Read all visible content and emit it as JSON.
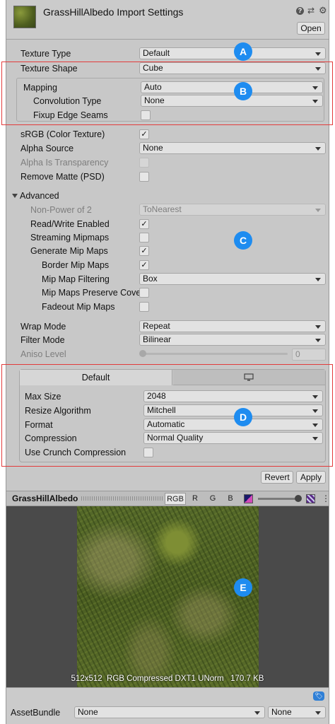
{
  "header": {
    "title": "GrassHillAlbedo Import Settings",
    "open_label": "Open",
    "help_icon": "help-icon",
    "settings_icon": "sliders-icon",
    "gear_icon": "gear-icon"
  },
  "fields": {
    "texture_type": {
      "label": "Texture Type",
      "value": "Default"
    },
    "texture_shape": {
      "label": "Texture Shape",
      "value": "Cube"
    },
    "mapping": {
      "label": "Mapping",
      "value": "Auto"
    },
    "convolution_type": {
      "label": "Convolution Type",
      "value": "None"
    },
    "fixup_edge_seams": {
      "label": "Fixup Edge Seams",
      "checked": false
    },
    "srgb": {
      "label": "sRGB (Color Texture)",
      "checked": true
    },
    "alpha_source": {
      "label": "Alpha Source",
      "value": "None"
    },
    "alpha_is_transparency": {
      "label": "Alpha Is Transparency",
      "checked": false
    },
    "remove_matte": {
      "label": "Remove Matte (PSD)",
      "checked": false
    }
  },
  "advanced": {
    "label": "Advanced",
    "non_power_of_2": {
      "label": "Non-Power of 2",
      "value": "ToNearest"
    },
    "read_write": {
      "label": "Read/Write Enabled",
      "checked": true
    },
    "streaming_mipmaps": {
      "label": "Streaming Mipmaps",
      "checked": false
    },
    "generate_mip_maps": {
      "label": "Generate Mip Maps",
      "checked": true
    },
    "border_mip_maps": {
      "label": "Border Mip Maps",
      "checked": true
    },
    "mip_map_filtering": {
      "label": "Mip Map Filtering",
      "value": "Box"
    },
    "mip_maps_preserve_coverage": {
      "label": "Mip Maps Preserve Cove",
      "checked": false
    },
    "fadeout_mip_maps": {
      "label": "Fadeout Mip Maps",
      "checked": false
    }
  },
  "wrap": {
    "wrap_mode": {
      "label": "Wrap Mode",
      "value": "Repeat"
    },
    "filter_mode": {
      "label": "Filter Mode",
      "value": "Bilinear"
    },
    "aniso_level": {
      "label": "Aniso Level",
      "value": "0"
    }
  },
  "platform": {
    "tabs": [
      {
        "label": "Default",
        "active": true
      },
      {
        "label": "",
        "icon": "monitor-icon",
        "active": false
      }
    ],
    "max_size": {
      "label": "Max Size",
      "value": "2048"
    },
    "resize_algorithm": {
      "label": "Resize Algorithm",
      "value": "Mitchell"
    },
    "format": {
      "label": "Format",
      "value": "Automatic"
    },
    "compression": {
      "label": "Compression",
      "value": "Normal Quality"
    },
    "crunch": {
      "label": "Use Crunch Compression",
      "checked": false
    }
  },
  "actions": {
    "revert": "Revert",
    "apply": "Apply"
  },
  "preview": {
    "title": "GrassHillAlbedo",
    "channels": [
      "RGB",
      "R",
      "G",
      "B"
    ],
    "info": "512x512  RGB Compressed DXT1 UNorm   170.7 KB"
  },
  "footer": {
    "assetbundle_label": "AssetBundle",
    "bundle_name": "None",
    "bundle_variant": "None"
  },
  "callouts": [
    "A",
    "B",
    "C",
    "D",
    "E"
  ]
}
